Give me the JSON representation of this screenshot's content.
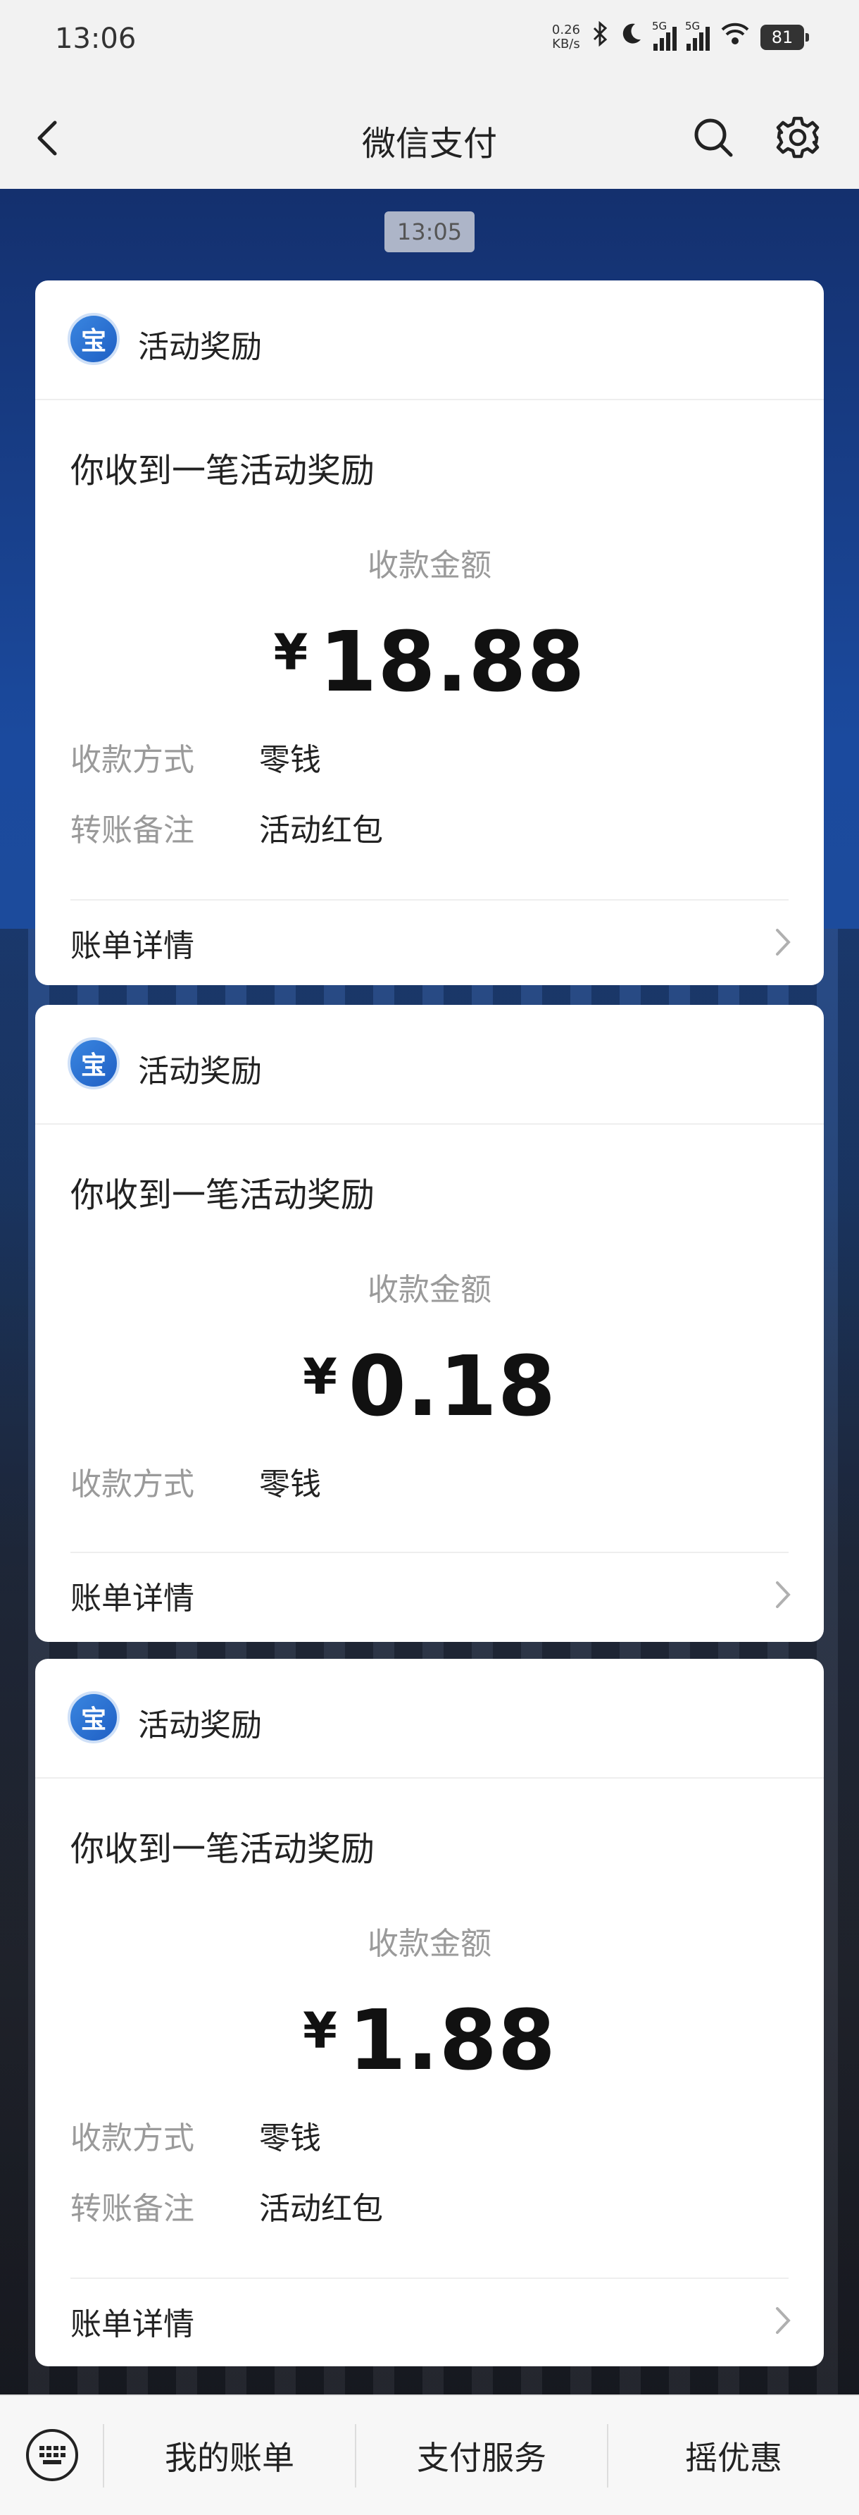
{
  "status_bar": {
    "time": "13:06",
    "net_speed_value": "0.26",
    "net_speed_unit": "KB/s",
    "signal_tag_1": "5G",
    "signal_tag_2": "5G",
    "battery": "81"
  },
  "header": {
    "title": "微信支付"
  },
  "chat": {
    "timestamp": "13:05"
  },
  "cards": [
    {
      "source": "活动奖励",
      "headline": "你收到一笔活动奖励",
      "amount_label": "收款金额",
      "currency": "¥",
      "amount": "18.88",
      "method_label": "收款方式",
      "method_value": "零钱",
      "note_label": "转账备注",
      "note_value": "活动红包",
      "detail_label": "账单详情"
    },
    {
      "source": "活动奖励",
      "headline": "你收到一笔活动奖励",
      "amount_label": "收款金额",
      "currency": "¥",
      "amount": "0.18",
      "method_label": "收款方式",
      "method_value": "零钱",
      "detail_label": "账单详情"
    },
    {
      "source": "活动奖励",
      "headline": "你收到一笔活动奖励",
      "amount_label": "收款金额",
      "currency": "¥",
      "amount": "1.88",
      "method_label": "收款方式",
      "method_value": "零钱",
      "note_label": "转账备注",
      "note_value": "活动红包",
      "detail_label": "账单详情"
    }
  ],
  "bottom_menu": {
    "items": [
      "我的账单",
      "支付服务",
      "摇优惠"
    ]
  },
  "icons": {
    "back": "chevron-left-icon",
    "search": "search-icon",
    "settings": "gear-icon",
    "keyboard": "keyboard-icon",
    "detail_arrow": "chevron-right-icon"
  }
}
